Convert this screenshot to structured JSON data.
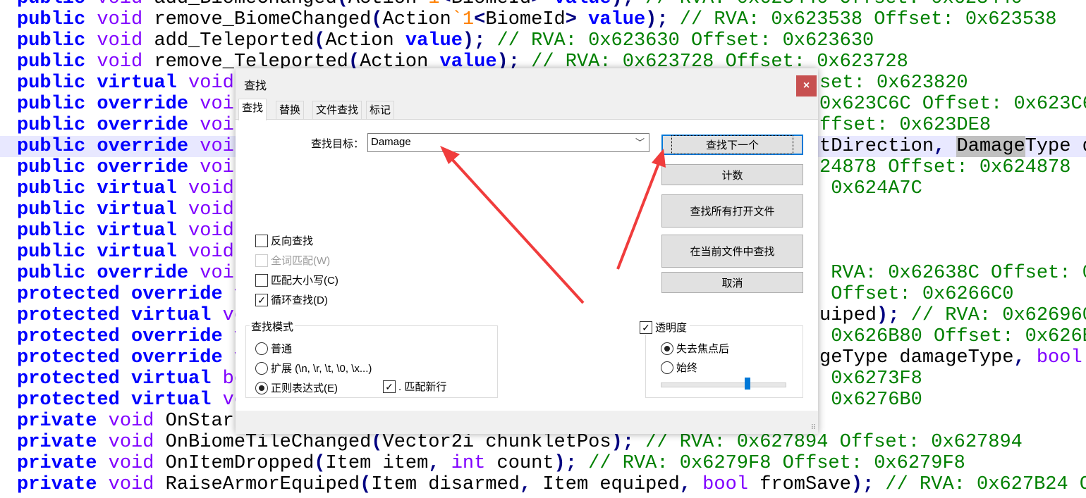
{
  "editor": {
    "highlight_line": 7,
    "lines": [
      {
        "left": [
          {
            "t": "public",
            "s": "kw"
          },
          {
            "t": " void ",
            "s": "ty"
          },
          {
            "t": "add_BiomeChanged",
            "s": "nm"
          },
          {
            "t": "(",
            "s": "pu"
          },
          {
            "t": "Action",
            "s": "nm"
          },
          {
            "t": "`1",
            "s": "or"
          },
          {
            "t": "<",
            "s": "pu"
          },
          {
            "t": "BiomeId",
            "s": "nm"
          },
          {
            "t": ">",
            "s": "pu"
          },
          {
            "t": " value",
            "s": "kw"
          },
          {
            "t": ");",
            "s": "pu"
          },
          {
            "t": " // RVA: 0x623440 Offset: 0x623440",
            "s": "cm"
          }
        ],
        "right": []
      },
      {
        "left": [
          {
            "t": "public",
            "s": "kw"
          },
          {
            "t": " void ",
            "s": "ty"
          },
          {
            "t": "remove_BiomeChanged",
            "s": "nm"
          },
          {
            "t": "(",
            "s": "pu"
          },
          {
            "t": "Action",
            "s": "nm"
          },
          {
            "t": "`1",
            "s": "or"
          },
          {
            "t": "<",
            "s": "pu"
          },
          {
            "t": "BiomeId",
            "s": "nm"
          },
          {
            "t": ">",
            "s": "pu"
          },
          {
            "t": " value",
            "s": "kw"
          },
          {
            "t": ");",
            "s": "pu"
          },
          {
            "t": " // RVA: 0x623538 Offset: 0x623538",
            "s": "cm"
          }
        ],
        "right": []
      },
      {
        "left": [
          {
            "t": "public",
            "s": "kw"
          },
          {
            "t": " void ",
            "s": "ty"
          },
          {
            "t": "add_Teleported",
            "s": "nm"
          },
          {
            "t": "(",
            "s": "pu"
          },
          {
            "t": "Action",
            "s": "nm"
          },
          {
            "t": " value",
            "s": "kw"
          },
          {
            "t": ");",
            "s": "pu"
          },
          {
            "t": " // RVA: 0x623630 Offset: 0x623630",
            "s": "cm"
          }
        ],
        "right": []
      },
      {
        "left": [
          {
            "t": "public",
            "s": "kw"
          },
          {
            "t": " void ",
            "s": "ty"
          },
          {
            "t": "remove_Teleported",
            "s": "nm"
          },
          {
            "t": "(",
            "s": "pu"
          },
          {
            "t": "Action",
            "s": "nm"
          },
          {
            "t": " value",
            "s": "kw"
          },
          {
            "t": ");",
            "s": "pu"
          },
          {
            "t": " // RVA: 0x623728 Offset: 0x623728",
            "s": "cm"
          }
        ],
        "right": []
      },
      {
        "left": [
          {
            "t": "public virtual",
            "s": "kw"
          },
          {
            "t": " void",
            "s": "ty"
          }
        ],
        "right": [
          {
            "t": "set: 0x623820",
            "s": "cm"
          }
        ]
      },
      {
        "left": [
          {
            "t": "public override",
            "s": "kw"
          },
          {
            "t": " voi",
            "s": "ty"
          }
        ],
        "right": [
          {
            "t": "0x623C6C Offset: 0x623C6",
            "s": "cm"
          }
        ]
      },
      {
        "left": [
          {
            "t": "public override",
            "s": "kw"
          },
          {
            "t": " voi",
            "s": "ty"
          }
        ],
        "right": [
          {
            "t": "ffset: 0x623DE8",
            "s": "cm"
          }
        ]
      },
      {
        "left": [
          {
            "t": "public override",
            "s": "kw"
          },
          {
            "t": " voi",
            "s": "ty"
          }
        ],
        "right": [
          {
            "t": "tDirection",
            "s": "nm"
          },
          {
            "t": ",",
            "s": "pu"
          },
          {
            "t": " ",
            "s": "nm"
          },
          {
            "t": "Damage",
            "s": "sel"
          },
          {
            "t": "Type d",
            "s": "nm"
          }
        ]
      },
      {
        "left": [
          {
            "t": "public override",
            "s": "kw"
          },
          {
            "t": " voi",
            "s": "ty"
          }
        ],
        "right": [
          {
            "t": "24878 Offset: 0x624878",
            "s": "cm"
          }
        ]
      },
      {
        "left": [
          {
            "t": "public virtual",
            "s": "kw"
          },
          {
            "t": " void",
            "s": "ty"
          }
        ],
        "right": [
          {
            "t": " 0x624A7C",
            "s": "cm"
          }
        ]
      },
      {
        "left": [
          {
            "t": "public virtual",
            "s": "kw"
          },
          {
            "t": " void",
            "s": "ty"
          }
        ],
        "right": []
      },
      {
        "left": [
          {
            "t": "public virtual",
            "s": "kw"
          },
          {
            "t": " void",
            "s": "ty"
          }
        ],
        "right": []
      },
      {
        "left": [
          {
            "t": "public virtual",
            "s": "kw"
          },
          {
            "t": " void",
            "s": "ty"
          }
        ],
        "right": []
      },
      {
        "left": [
          {
            "t": "public override",
            "s": "kw"
          },
          {
            "t": " voi",
            "s": "ty"
          }
        ],
        "right": [
          {
            "t": " RVA: 0x62638C Offset: 0",
            "s": "cm"
          }
        ]
      },
      {
        "left": [
          {
            "t": "protected override",
            "s": "kw"
          },
          {
            "t": " v",
            "s": "ty"
          }
        ],
        "right": [
          {
            "t": " Offset: 0x6266C0",
            "s": "cm"
          }
        ]
      },
      {
        "left": [
          {
            "t": "protected virtual",
            "s": "kw"
          },
          {
            "t": " vo",
            "s": "ty"
          }
        ],
        "right": [
          {
            "t": "uiped",
            "s": "nm"
          },
          {
            "t": ");",
            "s": "pu"
          },
          {
            "t": " // RVA: 0x626960",
            "s": "cm"
          }
        ]
      },
      {
        "left": [
          {
            "t": "protected override",
            "s": "kw"
          },
          {
            "t": " v",
            "s": "ty"
          }
        ],
        "right": [
          {
            "t": " 0x626B80 Offset: 0x626B",
            "s": "cm"
          }
        ]
      },
      {
        "left": [
          {
            "t": "protected override",
            "s": "kw"
          },
          {
            "t": " v",
            "s": "ty"
          }
        ],
        "right": [
          {
            "t": "geType damageType",
            "s": "nm"
          },
          {
            "t": ",",
            "s": "pu"
          },
          {
            "t": " bool",
            "s": "ty"
          }
        ]
      },
      {
        "left": [
          {
            "t": "protected virtual",
            "s": "kw"
          },
          {
            "t": " bo",
            "s": "ty"
          }
        ],
        "right": [
          {
            "t": " 0x6273F8",
            "s": "cm"
          }
        ]
      },
      {
        "left": [
          {
            "t": "protected virtual",
            "s": "kw"
          },
          {
            "t": " vo",
            "s": "ty"
          }
        ],
        "right": [
          {
            "t": " 0x6276B0",
            "s": "cm"
          }
        ]
      },
      {
        "left": [
          {
            "t": "private",
            "s": "kw"
          },
          {
            "t": " void ",
            "s": "ty"
          },
          {
            "t": "OnStart",
            "s": "nm"
          }
        ],
        "right": []
      },
      {
        "left": [
          {
            "t": "private",
            "s": "kw"
          },
          {
            "t": " void ",
            "s": "ty"
          },
          {
            "t": "OnBiomeTileChanged",
            "s": "nm"
          },
          {
            "t": "(",
            "s": "pu"
          },
          {
            "t": "Vector2i chunkletPos",
            "s": "nm"
          },
          {
            "t": ");",
            "s": "pu"
          },
          {
            "t": " // RVA: 0x627894 Offset: 0x627894",
            "s": "cm"
          }
        ],
        "right": []
      },
      {
        "left": [
          {
            "t": "private",
            "s": "kw"
          },
          {
            "t": " void ",
            "s": "ty"
          },
          {
            "t": "OnItemDropped",
            "s": "nm"
          },
          {
            "t": "(",
            "s": "pu"
          },
          {
            "t": "Item item",
            "s": "nm"
          },
          {
            "t": ",",
            "s": "pu"
          },
          {
            "t": " int",
            "s": "ty"
          },
          {
            "t": " count",
            "s": "nm"
          },
          {
            "t": ");",
            "s": "pu"
          },
          {
            "t": " // RVA: 0x6279F8 Offset: 0x6279F8",
            "s": "cm"
          }
        ],
        "right": []
      },
      {
        "left": [
          {
            "t": "private",
            "s": "kw"
          },
          {
            "t": " void ",
            "s": "ty"
          },
          {
            "t": "RaiseArmorEquiped",
            "s": "nm"
          },
          {
            "t": "(",
            "s": "pu"
          },
          {
            "t": "Item disarmed",
            "s": "nm"
          },
          {
            "t": ",",
            "s": "pu"
          },
          {
            "t": " Item equiped",
            "s": "nm"
          },
          {
            "t": ",",
            "s": "pu"
          },
          {
            "t": " bool",
            "s": "ty"
          },
          {
            "t": " fromSave",
            "s": "nm"
          },
          {
            "t": ");",
            "s": "pu"
          },
          {
            "t": " // RVA: 0x627B24 Of",
            "s": "cm"
          }
        ],
        "right": []
      }
    ]
  },
  "dialog": {
    "title": "查找",
    "close_icon": "×",
    "tabs": [
      "查找",
      "替换",
      "文件查找",
      "标记"
    ],
    "active_tab": 0,
    "find_label": "查找目标：",
    "find_value": "Damage",
    "dropdown_icon": "﹀",
    "buttons": {
      "find_next": "查找下一个",
      "count": "计数",
      "find_all_open": "查找所有打开文件",
      "find_in_current": "在当前文件中查找",
      "cancel": "取消"
    },
    "options": {
      "backward": {
        "label": "反向查找",
        "checked": false
      },
      "whole_word": {
        "label": "全词匹配(W)",
        "checked": false,
        "disabled": true
      },
      "match_case": {
        "label": "匹配大小写(C)",
        "checked": false
      },
      "wrap": {
        "label": "循环查找(D)",
        "checked": true
      }
    },
    "search_mode": {
      "legend": "查找模式",
      "normal": "普通",
      "extended": "扩展 (\\n, \\r, \\t, \\0, \\x...)",
      "regex": "正则表达式(E)",
      "selected": "regex",
      "dot_newline": {
        "label": ". 匹配新行",
        "checked": true
      }
    },
    "transparency": {
      "label": "透明度",
      "checked": true,
      "on_lose_focus": "失去焦点后",
      "always": "始终",
      "selected": "on_lose_focus",
      "level": 0.7
    },
    "check_glyph": "✓"
  },
  "annotation_color": "#f03c3c"
}
